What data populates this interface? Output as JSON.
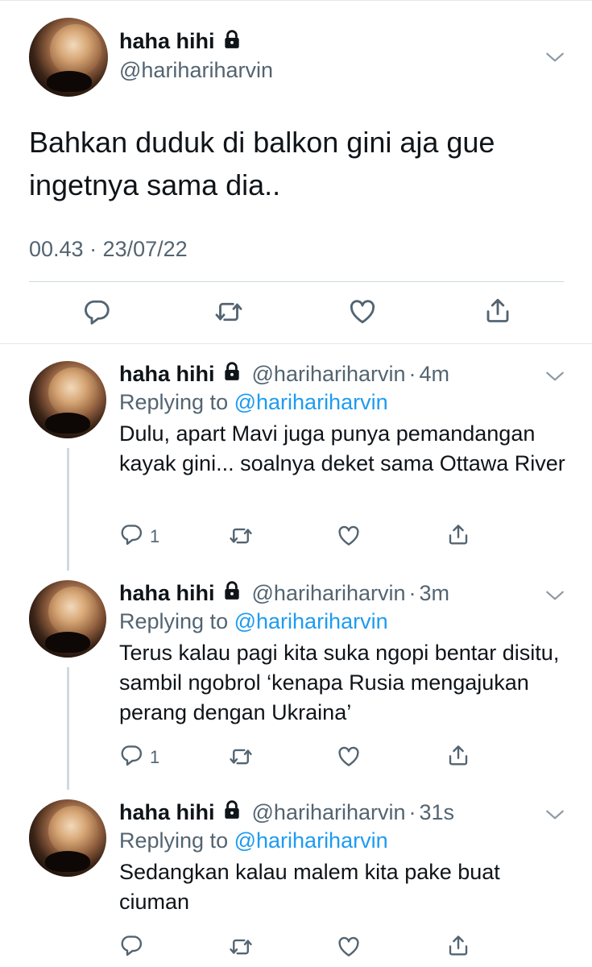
{
  "main_tweet": {
    "name": "haha hihi",
    "handle": "@harihariharvin",
    "text": "Bahkan duduk di balkon gini aja gue ingetnya sama dia..",
    "timestamp": "00.43 · 23/07/22",
    "icons": [
      "reply-icon",
      "retweet-icon",
      "like-icon",
      "share-icon"
    ]
  },
  "replies": [
    {
      "name": "haha hihi",
      "handle": "@harihariharvin",
      "separator": "·",
      "ago": "4m",
      "replying_prefix": "Replying to",
      "replying_to": "@harihariharvin",
      "text": "Dulu, apart Mavi juga punya pemandangan kayak gini... soalnya deket sama Ottawa River",
      "reply_count": "1"
    },
    {
      "name": "haha hihi",
      "handle": "@harihariharvin",
      "separator": "·",
      "ago": "3m",
      "replying_prefix": "Replying to",
      "replying_to": "@harihariharvin",
      "text": "Terus kalau pagi kita suka ngopi bentar disitu, sambil ngobrol ‘kenapa Rusia mengajukan perang dengan Ukraina’",
      "reply_count": "1"
    },
    {
      "name": "haha hihi",
      "handle": "@harihariharvin",
      "separator": "·",
      "ago": "31s",
      "replying_prefix": "Replying to",
      "replying_to": "@harihariharvin",
      "text": "Sedangkan kalau malem kita pake buat ciuman",
      "reply_count": ""
    }
  ],
  "colors": {
    "text": "#0f1419",
    "secondary": "#536471",
    "link": "#1d9bf0",
    "divider": "#cfd9de"
  }
}
